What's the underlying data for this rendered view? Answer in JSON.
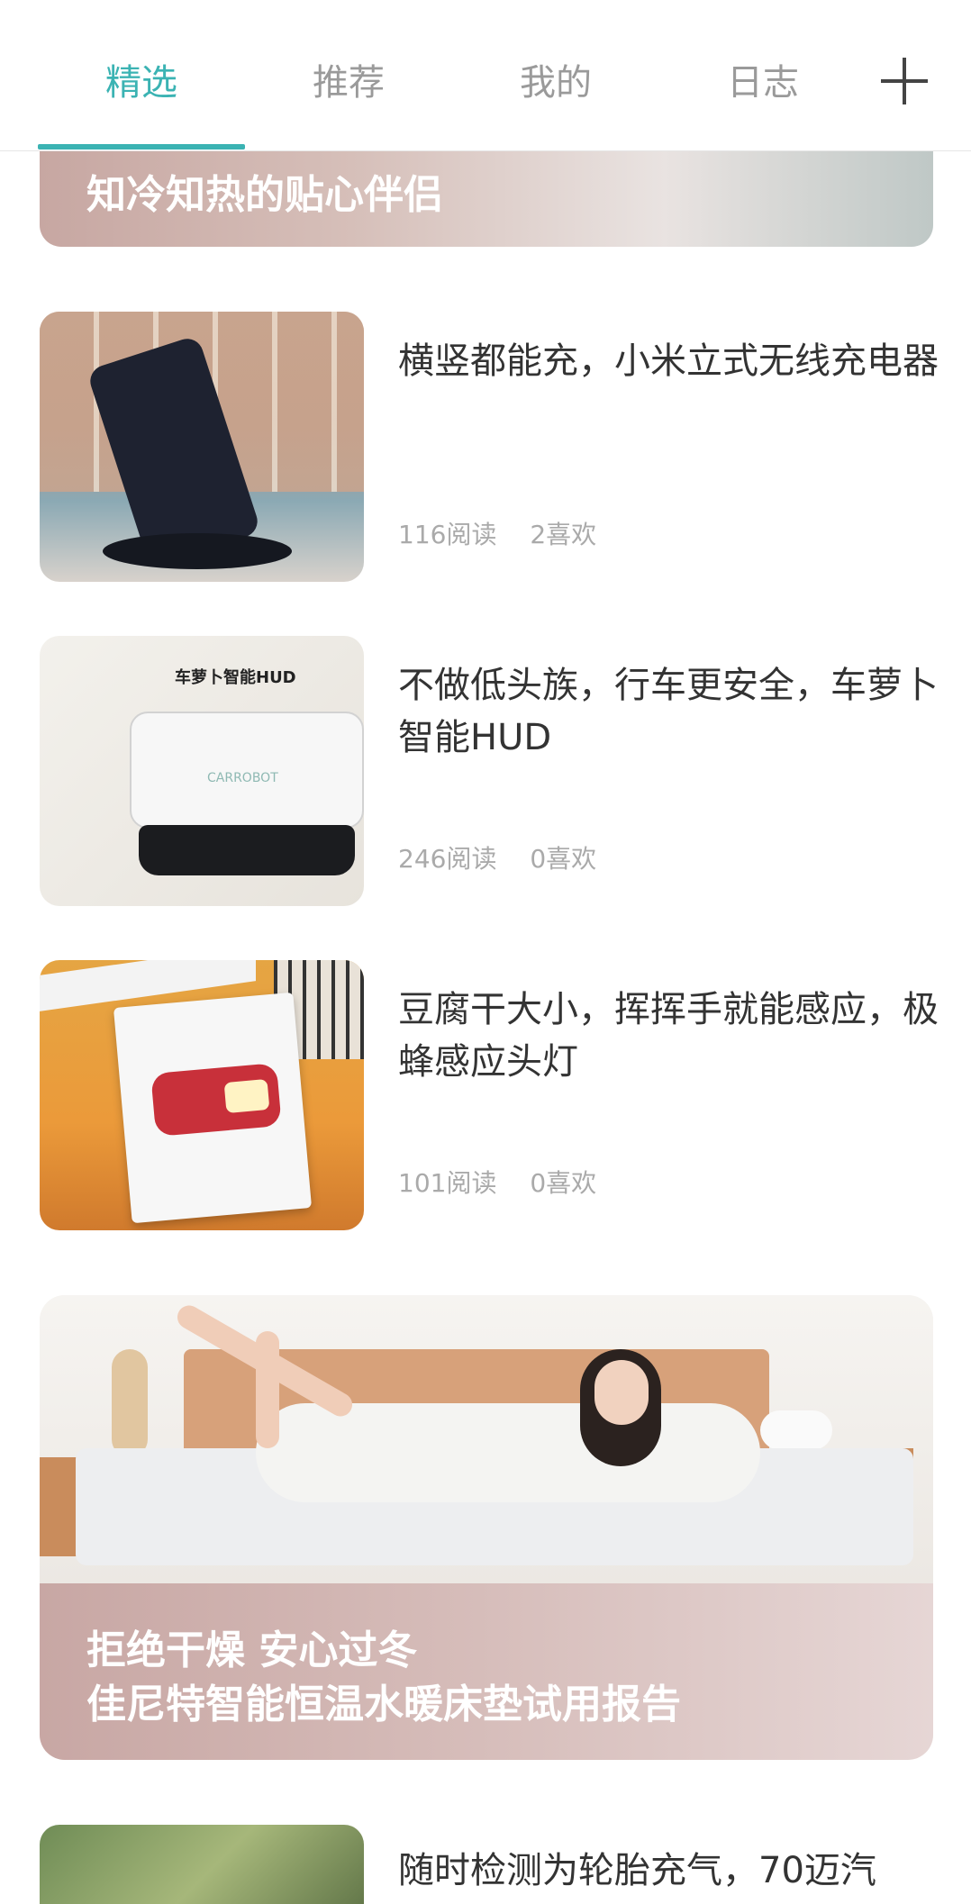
{
  "tabs": [
    {
      "label": "精选",
      "active": true
    },
    {
      "label": "推荐",
      "active": false
    },
    {
      "label": "我的",
      "active": false
    },
    {
      "label": "日志",
      "active": false
    }
  ],
  "add_icon": "plus-icon",
  "accent_color": "#3bb3b3",
  "banner_top": {
    "title": "知冷知热的贴心伴侣"
  },
  "articles": [
    {
      "title": "横竖都能充，小米立式无线充电器",
      "reads": "116阅读",
      "likes": "2喜欢"
    },
    {
      "title": "不做低头族，行车更安全，车萝卜智能HUD",
      "reads": "246阅读",
      "likes": "0喜欢",
      "thumb_label": "车萝卜智能HUD",
      "thumb_logo": "CARROBOT"
    },
    {
      "title": "豆腐干大小，挥挥手就能感应，极蜂感应头灯",
      "reads": "101阅读",
      "likes": "0喜欢"
    }
  ],
  "banner_big": {
    "line1": "拒绝干燥  安心过冬",
    "line2": "佳尼特智能恒温水暖床垫试用报告"
  },
  "article_bottom": {
    "title": "随时检测为轮胎充气，70迈汽"
  }
}
